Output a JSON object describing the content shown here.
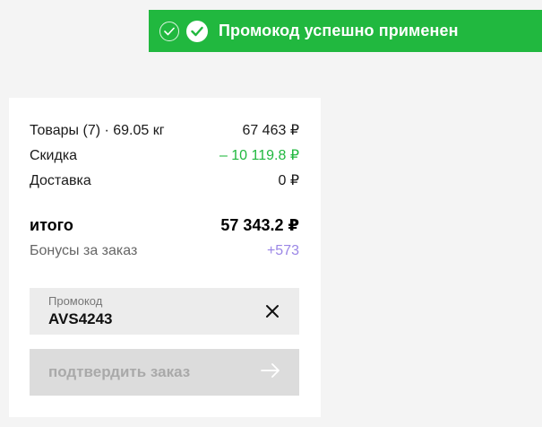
{
  "toast": {
    "message": "Промокод успешно применен",
    "color": "#21b83f",
    "icons": [
      "check-circle-outline-icon",
      "check-circle-icon"
    ]
  },
  "summary": {
    "goods_label": "Товары (7) · 69.05 кг",
    "goods_value": "67 463 ₽",
    "discount_label": "Скидка",
    "discount_value": "– 10 119.8 ₽",
    "delivery_label": "Доставка",
    "delivery_value": "0 ₽",
    "total_label": "итого",
    "total_value": "57 343.2 ₽",
    "bonus_label": "Бонусы за заказ",
    "bonus_value": "+573"
  },
  "promo": {
    "placeholder": "Промокод",
    "value": "AVS4243",
    "clear_icon": "close-icon"
  },
  "confirm_button": {
    "label": "подтвердить заказ",
    "icon": "arrow-right-icon",
    "state": "disabled"
  },
  "colors": {
    "accent_green": "#21b83f",
    "bonus_purple": "#9b87e6",
    "disabled_bg": "#dcdcdc"
  }
}
